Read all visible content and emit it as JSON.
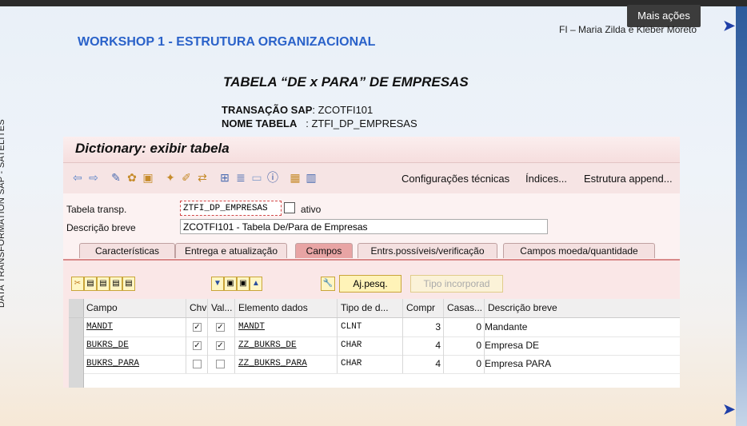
{
  "tooltip": "Mais ações",
  "sidebar_vertical": "DATA TRANSFORMATION  SAP  -  SATÉLITES",
  "slide": {
    "workshop_title": "WORKSHOP 1  -  ESTRUTURA ORGANIZACIONAL",
    "author": "FI – Maria Zilda e Kleber Moreto",
    "heading": "TABELA “DE x PARA” DE EMPRESAS",
    "transacao_label": "TRANSAÇÃO SAP",
    "transacao_value": ": ZCOTFI101",
    "nome_label": "NOME TABELA",
    "nome_value": ": ZTFI_DP_EMPRESAS"
  },
  "sap": {
    "window_title": "Dictionary: exibir tabela",
    "toolbar": {
      "config_tecnicas": "Configurações técnicas",
      "indices": "Índices...",
      "estrutura_append": "Estrutura append..."
    },
    "form": {
      "tabela_label": "Tabela transp.",
      "tabela_value": "ZTFI_DP_EMPRESAS",
      "status": "ativo",
      "descricao_label": "Descrição breve",
      "descricao_value": "ZCOTFI101 - Tabela De/Para de Empresas"
    },
    "tabs": [
      "Características",
      "Entrega e atualização",
      "Campos",
      "Entrs.possíveis/verificação",
      "Campos moeda/quantidade"
    ],
    "buttons": {
      "ajpesq": "Aj.pesq.",
      "tipo_incorporado": "Tipo incorporad"
    },
    "columns": [
      "Campo",
      "Chv",
      "Val...",
      "Elemento dados",
      "Tipo de d...",
      "Compr",
      "Casas...",
      "Descrição breve"
    ],
    "rows": [
      {
        "campo": "MANDT",
        "chv": true,
        "val": true,
        "elemento": "MANDT",
        "tipo": "CLNT",
        "compr": "3",
        "casas": "0",
        "descricao": "Mandante"
      },
      {
        "campo": "BUKRS_DE",
        "chv": true,
        "val": true,
        "elemento": "ZZ_BUKRS_DE",
        "tipo": "CHAR",
        "compr": "4",
        "casas": "0",
        "descricao": "Empresa DE"
      },
      {
        "campo": "BUKRS_PARA",
        "chv": false,
        "val": false,
        "elemento": "ZZ_BUKRS_PARA",
        "tipo": "CHAR",
        "compr": "4",
        "casas": "0",
        "descricao": "Empresa PARA"
      }
    ]
  }
}
